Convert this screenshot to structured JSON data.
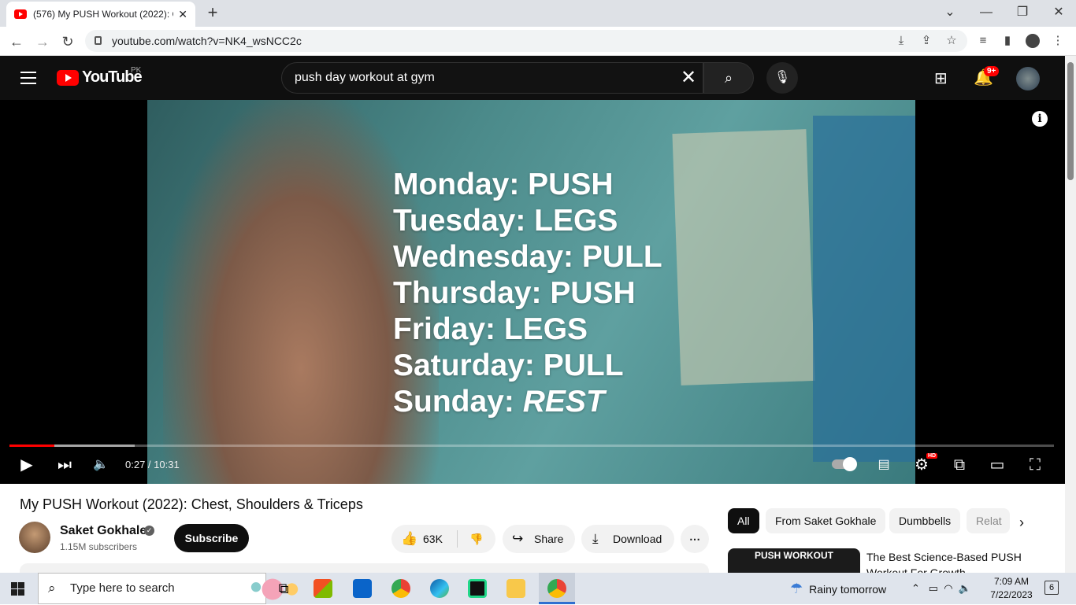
{
  "browser": {
    "tab_title": "(576) My PUSH Workout (2022): C",
    "tab_close": "✕",
    "new_tab": "+",
    "url": "youtube.com/watch?v=NK4_wsNCC2c",
    "win_min": "—",
    "win_max": "❐",
    "win_close": "✕"
  },
  "youtube": {
    "logo_text": "YouTube",
    "country": "PK",
    "search_value": "push day workout at gym",
    "notification_count": "9+"
  },
  "video": {
    "overlay_lines": [
      "Monday: PUSH",
      "Tuesday: LEGS",
      "Wednesday: PULL",
      "Thursday: PUSH",
      "Friday: LEGS",
      "Saturday: PULL",
      "Sunday: REST"
    ],
    "sunday_prefix": "Sunday: ",
    "sunday_value": "REST",
    "current_time": "0:27",
    "duration": "10:31",
    "time_display": "0:27 / 10:31",
    "played_fraction": 0.043,
    "buffered_fraction": 0.12,
    "hd_badge": "HD"
  },
  "details": {
    "title": "My PUSH Workout (2022): Chest, Shoulders & Triceps",
    "channel": "Saket Gokhale",
    "subscribers": "1.15M subscribers",
    "subscribe": "Subscribe",
    "likes": "63K",
    "share": "Share",
    "download": "Download"
  },
  "chips": [
    "All",
    "From Saket Gokhale",
    "Dumbbells",
    "Relat"
  ],
  "related": {
    "thumb_text": "PUSH WORKOUT",
    "title": "The Best Science-Based PUSH Workout For Growth"
  },
  "taskbar": {
    "search_placeholder": "Type here to search",
    "weather": "Rainy tomorrow",
    "time": "7:09 AM",
    "date": "7/22/2023",
    "notif_count": "6"
  },
  "colors": {
    "youtube_red": "#ff0000",
    "header_bg": "#0f0f0f",
    "teal_video": "#4b8a8a"
  }
}
